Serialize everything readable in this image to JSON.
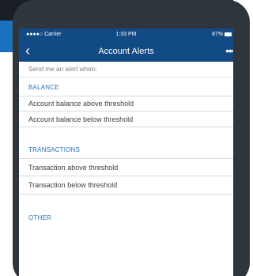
{
  "status": {
    "carrier": "●●●●○ Carrier",
    "time": "1:33 PM",
    "battery": "87%"
  },
  "nav": {
    "back_icon": "chevron-left-icon",
    "title": "Account Alerts",
    "more_icon": "more-icon"
  },
  "intro": "Send me an alert when:",
  "sections": [
    {
      "header": "BALANCE",
      "items": [
        "Account balance above threshold",
        "Account balance below threshold"
      ]
    },
    {
      "header": "TRANSACTIONS",
      "items": [
        "Transaction above threshold",
        "Transaction below threshold"
      ]
    },
    {
      "header": "OTHER",
      "items": []
    }
  ],
  "colors": {
    "nav": "#124a86",
    "accent": "#2a72b8",
    "frame": "#2f353d",
    "brand": "#1c70c0"
  }
}
